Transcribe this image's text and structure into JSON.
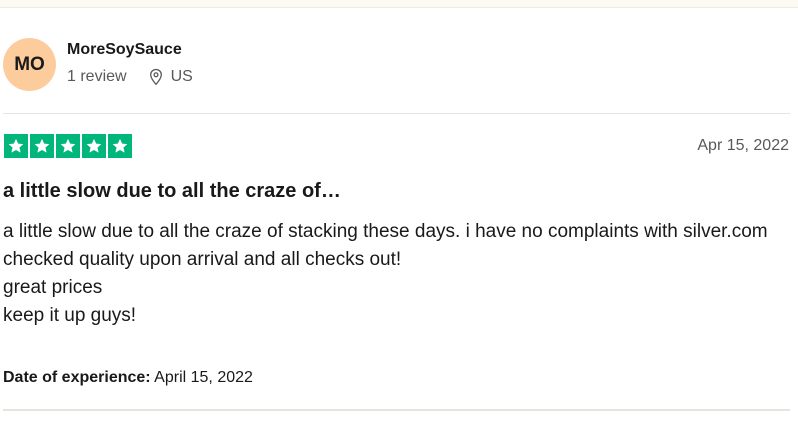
{
  "reviewer": {
    "initials": "MO",
    "name": "MoreSoySauce",
    "review_count": "1 review",
    "country": "US",
    "location_icon": "location-pin-icon"
  },
  "review": {
    "rating": 5,
    "star_color": "#00b67a",
    "date": "Apr 15, 2022",
    "title": "a little slow due to all the craze of…",
    "body_lines": [
      "a little slow due to all the craze of stacking these days. i have no complaints with silver.com",
      "checked quality upon arrival and all checks out!",
      "great prices",
      "keep it up guys!"
    ],
    "experience_label": "Date of experience:",
    "experience_date": "April 15, 2022"
  },
  "colors": {
    "avatar_bg": "#fccc9c",
    "muted_text": "#595959"
  }
}
